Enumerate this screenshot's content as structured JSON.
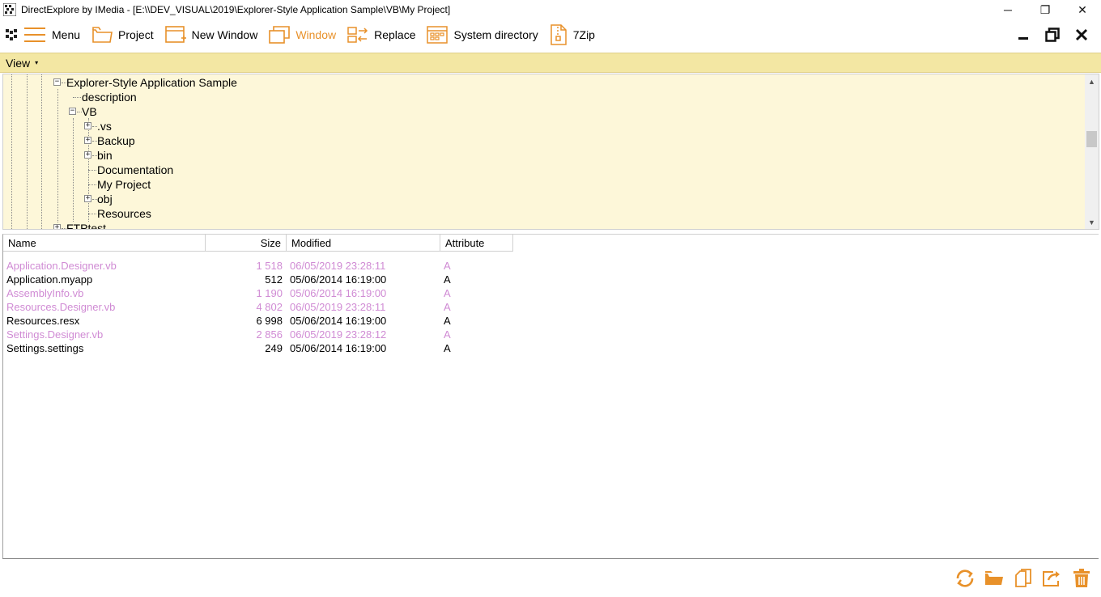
{
  "window": {
    "title": "DirectExplore by IMedia - [E:\\\\DEV_VISUAL\\2019\\Explorer-Style Application Sample\\VB\\My Project]",
    "minimize_glyph": "─",
    "restore_glyph": "❐",
    "close_glyph": "✕"
  },
  "toolbar": {
    "items": [
      {
        "label": "Menu",
        "icon": "hamburger-icon"
      },
      {
        "label": "Project",
        "icon": "folder-icon"
      },
      {
        "label": "New Window",
        "icon": "new-window-icon"
      },
      {
        "label": "Window",
        "icon": "window-icon",
        "active": true
      },
      {
        "label": "Replace",
        "icon": "replace-icon"
      },
      {
        "label": "System directory",
        "icon": "system-directory-icon"
      },
      {
        "label": "7Zip",
        "icon": "zip-icon"
      }
    ],
    "accent_color": "#e8912a"
  },
  "viewbar": {
    "label": "View",
    "caret": "▾"
  },
  "tree": {
    "nodes": [
      {
        "label": "Explorer-Style Application Sample",
        "expander": "−"
      },
      {
        "label": "description"
      },
      {
        "label": "VB",
        "expander": "−"
      },
      {
        "label": ".vs",
        "expander": "+"
      },
      {
        "label": "Backup",
        "expander": "+"
      },
      {
        "label": "bin",
        "expander": "+"
      },
      {
        "label": "Documentation"
      },
      {
        "label": "My Project"
      },
      {
        "label": "obj",
        "expander": "+"
      },
      {
        "label": "Resources"
      },
      {
        "label": "FTPtest",
        "expander": "+"
      }
    ],
    "background": "#fdf7d9"
  },
  "list": {
    "columns": [
      "Name",
      "Size",
      "Modified",
      "Attribute"
    ],
    "rows": [
      {
        "name": "Application.Designer.vb",
        "size": "1 518",
        "modified": "06/05/2019 23:28:11",
        "attr": "A",
        "dim": true
      },
      {
        "name": "Application.myapp",
        "size": "512",
        "modified": "05/06/2014 16:19:00",
        "attr": "A",
        "dim": false
      },
      {
        "name": "AssemblyInfo.vb",
        "size": "1 190",
        "modified": "05/06/2014 16:19:00",
        "attr": "A",
        "dim": true
      },
      {
        "name": "Resources.Designer.vb",
        "size": "4 802",
        "modified": "06/05/2019 23:28:11",
        "attr": "A",
        "dim": true
      },
      {
        "name": "Resources.resx",
        "size": "6 998",
        "modified": "05/06/2014 16:19:00",
        "attr": "A",
        "dim": false
      },
      {
        "name": "Settings.Designer.vb",
        "size": "2 856",
        "modified": "06/05/2019 23:28:12",
        "attr": "A",
        "dim": true
      },
      {
        "name": "Settings.settings",
        "size": "249",
        "modified": "05/06/2014 16:19:00",
        "attr": "A",
        "dim": false
      }
    ],
    "dim_color": "#d08bd4"
  },
  "bottom_actions": [
    "refresh-icon",
    "open-folder-icon",
    "copy-icon",
    "move-icon",
    "delete-icon"
  ]
}
